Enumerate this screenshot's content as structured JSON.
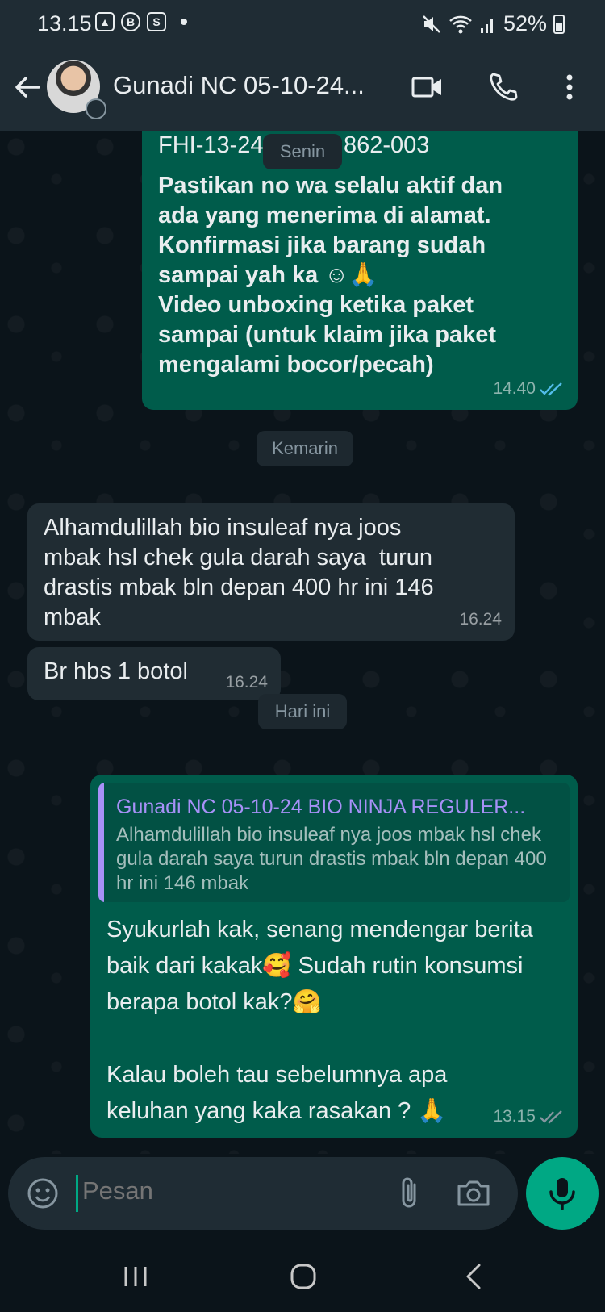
{
  "status_bar": {
    "time": "13.15",
    "battery": "52%"
  },
  "header": {
    "title": "Gunadi NC 05-10-24..."
  },
  "messages": [
    {
      "type": "out",
      "text_line1_a": "FHI-13-24",
      "text_line1_b": "862-003",
      "bold_text": "Pastikan no wa selalu aktif dan\nada yang menerima di alamat.\nKonfirmasi jika barang sudah\nsampai yah ka ☺🙏\nVideo unboxing ketika paket\nsampai (untuk klaim jika paket\nmengalami bocor/pecah)",
      "time": "14.40"
    },
    {
      "type": "in",
      "text": "Alhamdulillah bio insuleaf nya joos\nmbak hsl chek gula darah saya  turun\ndrastis mbak bln depan 400 hr ini 146\nmbak",
      "time": "16.24"
    },
    {
      "type": "in",
      "text": "Br hbs 1 botol",
      "time": "16.24"
    },
    {
      "type": "out",
      "reply_name": "Gunadi NC 05-10-24 BIO NINJA REGULER...",
      "reply_text": "Alhamdulillah bio insuleaf nya joos mbak hsl chek gula darah saya  turun drastis mbak bln depan 400 hr ini 146 mbak",
      "text": "Syukurlah kak, senang mendengar berita\nbaik dari kakak🥰 Sudah rutin konsumsi\nberapa botol kak?🤗\n\nKalau boleh tau sebelumnya apa\nkeluhan yang kaka rasakan ? 🙏",
      "time": "13.15"
    }
  ],
  "date_pills": {
    "senin": "Senin",
    "kemarin": "Kemarin",
    "hari_ini": "Hari ini"
  },
  "input": {
    "placeholder": "Pesan"
  },
  "colors": {
    "outgoing_bubble": "#005c4b",
    "incoming_bubble": "#202c33",
    "accent": "#00a884",
    "read_ticks": "#53bdeb"
  }
}
